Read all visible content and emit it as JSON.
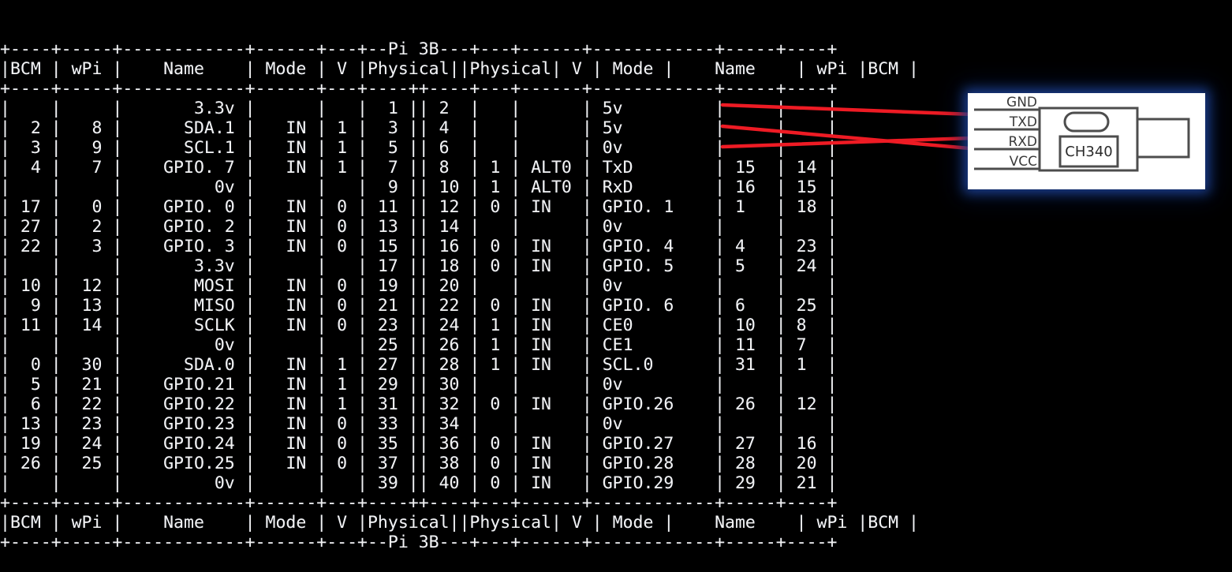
{
  "terminal": {
    "title": "Pi 3B",
    "columns": [
      "BCM",
      "wPi",
      "Name",
      "Mode",
      "V",
      "Physical",
      "V",
      "Mode",
      "Name",
      "wPi",
      "BCM"
    ],
    "rows": [
      {
        "bcm_l": "",
        "wpi_l": "",
        "name_l": "3.3v",
        "mode_l": "",
        "v_l": "",
        "phys_l": "1",
        "phys_r": "2",
        "v_r": "",
        "mode_r": "",
        "name_r": "5v",
        "wpi_r": "",
        "bcm_r": ""
      },
      {
        "bcm_l": "2",
        "wpi_l": "8",
        "name_l": "SDA.1",
        "mode_l": "IN",
        "v_l": "1",
        "phys_l": "3",
        "phys_r": "4",
        "v_r": "",
        "mode_r": "",
        "name_r": "5v",
        "wpi_r": "",
        "bcm_r": ""
      },
      {
        "bcm_l": "3",
        "wpi_l": "9",
        "name_l": "SCL.1",
        "mode_l": "IN",
        "v_l": "1",
        "phys_l": "5",
        "phys_r": "6",
        "v_r": "",
        "mode_r": "",
        "name_r": "0v",
        "wpi_r": "",
        "bcm_r": ""
      },
      {
        "bcm_l": "4",
        "wpi_l": "7",
        "name_l": "GPIO. 7",
        "mode_l": "IN",
        "v_l": "1",
        "phys_l": "7",
        "phys_r": "8",
        "v_r": "1",
        "mode_r": "ALT0",
        "name_r": "TxD",
        "wpi_r": "15",
        "bcm_r": "14"
      },
      {
        "bcm_l": "",
        "wpi_l": "",
        "name_l": "0v",
        "mode_l": "",
        "v_l": "",
        "phys_l": "9",
        "phys_r": "10",
        "v_r": "1",
        "mode_r": "ALT0",
        "name_r": "RxD",
        "wpi_r": "16",
        "bcm_r": "15"
      },
      {
        "bcm_l": "17",
        "wpi_l": "0",
        "name_l": "GPIO. 0",
        "mode_l": "IN",
        "v_l": "0",
        "phys_l": "11",
        "phys_r": "12",
        "v_r": "0",
        "mode_r": "IN",
        "name_r": "GPIO. 1",
        "wpi_r": "1",
        "bcm_r": "18"
      },
      {
        "bcm_l": "27",
        "wpi_l": "2",
        "name_l": "GPIO. 2",
        "mode_l": "IN",
        "v_l": "0",
        "phys_l": "13",
        "phys_r": "14",
        "v_r": "",
        "mode_r": "",
        "name_r": "0v",
        "wpi_r": "",
        "bcm_r": ""
      },
      {
        "bcm_l": "22",
        "wpi_l": "3",
        "name_l": "GPIO. 3",
        "mode_l": "IN",
        "v_l": "0",
        "phys_l": "15",
        "phys_r": "16",
        "v_r": "0",
        "mode_r": "IN",
        "name_r": "GPIO. 4",
        "wpi_r": "4",
        "bcm_r": "23"
      },
      {
        "bcm_l": "",
        "wpi_l": "",
        "name_l": "3.3v",
        "mode_l": "",
        "v_l": "",
        "phys_l": "17",
        "phys_r": "18",
        "v_r": "0",
        "mode_r": "IN",
        "name_r": "GPIO. 5",
        "wpi_r": "5",
        "bcm_r": "24"
      },
      {
        "bcm_l": "10",
        "wpi_l": "12",
        "name_l": "MOSI",
        "mode_l": "IN",
        "v_l": "0",
        "phys_l": "19",
        "phys_r": "20",
        "v_r": "",
        "mode_r": "",
        "name_r": "0v",
        "wpi_r": "",
        "bcm_r": ""
      },
      {
        "bcm_l": "9",
        "wpi_l": "13",
        "name_l": "MISO",
        "mode_l": "IN",
        "v_l": "0",
        "phys_l": "21",
        "phys_r": "22",
        "v_r": "0",
        "mode_r": "IN",
        "name_r": "GPIO. 6",
        "wpi_r": "6",
        "bcm_r": "25"
      },
      {
        "bcm_l": "11",
        "wpi_l": "14",
        "name_l": "SCLK",
        "mode_l": "IN",
        "v_l": "0",
        "phys_l": "23",
        "phys_r": "24",
        "v_r": "1",
        "mode_r": "IN",
        "name_r": "CE0",
        "wpi_r": "10",
        "bcm_r": "8"
      },
      {
        "bcm_l": "",
        "wpi_l": "",
        "name_l": "0v",
        "mode_l": "",
        "v_l": "",
        "phys_l": "25",
        "phys_r": "26",
        "v_r": "1",
        "mode_r": "IN",
        "name_r": "CE1",
        "wpi_r": "11",
        "bcm_r": "7"
      },
      {
        "bcm_l": "0",
        "wpi_l": "30",
        "name_l": "SDA.0",
        "mode_l": "IN",
        "v_l": "1",
        "phys_l": "27",
        "phys_r": "28",
        "v_r": "1",
        "mode_r": "IN",
        "name_r": "SCL.0",
        "wpi_r": "31",
        "bcm_r": "1"
      },
      {
        "bcm_l": "5",
        "wpi_l": "21",
        "name_l": "GPIO.21",
        "mode_l": "IN",
        "v_l": "1",
        "phys_l": "29",
        "phys_r": "30",
        "v_r": "",
        "mode_r": "",
        "name_r": "0v",
        "wpi_r": "",
        "bcm_r": ""
      },
      {
        "bcm_l": "6",
        "wpi_l": "22",
        "name_l": "GPIO.22",
        "mode_l": "IN",
        "v_l": "1",
        "phys_l": "31",
        "phys_r": "32",
        "v_r": "0",
        "mode_r": "IN",
        "name_r": "GPIO.26",
        "wpi_r": "26",
        "bcm_r": "12"
      },
      {
        "bcm_l": "13",
        "wpi_l": "23",
        "name_l": "GPIO.23",
        "mode_l": "IN",
        "v_l": "0",
        "phys_l": "33",
        "phys_r": "34",
        "v_r": "",
        "mode_r": "",
        "name_r": "0v",
        "wpi_r": "",
        "bcm_r": ""
      },
      {
        "bcm_l": "19",
        "wpi_l": "24",
        "name_l": "GPIO.24",
        "mode_l": "IN",
        "v_l": "0",
        "phys_l": "35",
        "phys_r": "36",
        "v_r": "0",
        "mode_r": "IN",
        "name_r": "GPIO.27",
        "wpi_r": "27",
        "bcm_r": "16"
      },
      {
        "bcm_l": "26",
        "wpi_l": "25",
        "name_l": "GPIO.25",
        "mode_l": "IN",
        "v_l": "0",
        "phys_l": "37",
        "phys_r": "38",
        "v_r": "0",
        "mode_r": "IN",
        "name_r": "GPIO.28",
        "wpi_r": "28",
        "bcm_r": "20"
      },
      {
        "bcm_l": "",
        "wpi_l": "",
        "name_l": "0v",
        "mode_l": "",
        "v_l": "",
        "phys_l": "39",
        "phys_r": "40",
        "v_r": "0",
        "mode_r": "IN",
        "name_r": "GPIO.29",
        "wpi_r": "29",
        "bcm_r": "21"
      }
    ]
  },
  "adapter": {
    "chip_label": "CH340",
    "pins": [
      "GND",
      "TXD",
      "RXD",
      "VCC"
    ]
  },
  "wires": {
    "color": "#ee1b24",
    "connections": [
      {
        "from": "0v",
        "to": "GND"
      },
      {
        "from": "TxD",
        "to": "RXD"
      },
      {
        "from": "RxD",
        "to": "TXD"
      }
    ]
  },
  "colors": {
    "terminal_bg": "#000000",
    "terminal_fg": "#ffffff",
    "wire_red": "#ee1b24",
    "panel_bg": "#ffffff",
    "panel_glow": "#1e46a0",
    "outline": "#4a4a4a"
  }
}
